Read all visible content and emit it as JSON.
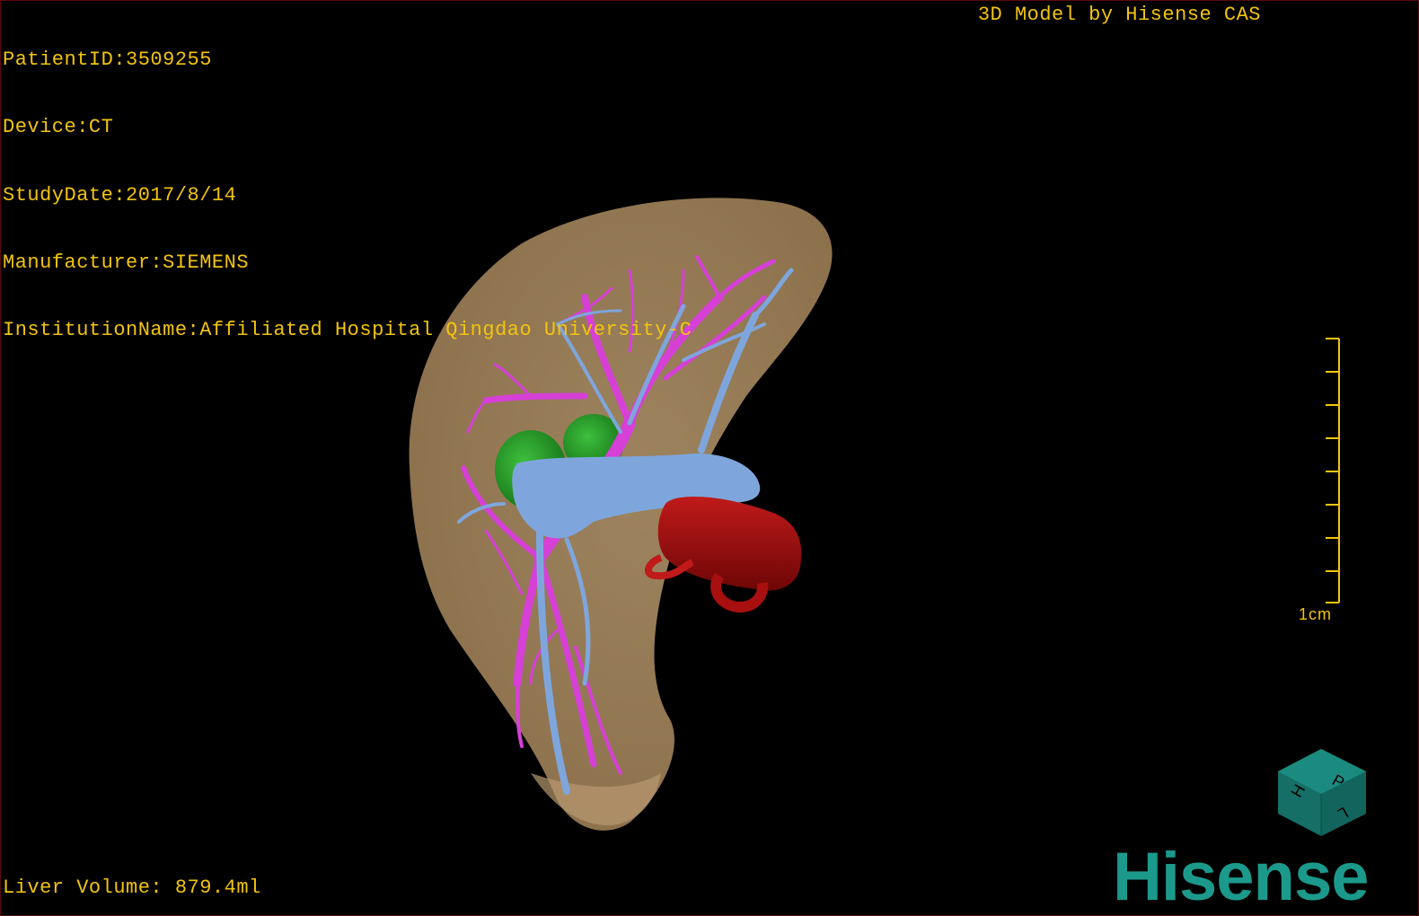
{
  "overlay": {
    "patient_id": "PatientID:3509255",
    "device": "Device:CT",
    "study_date": "StudyDate:2017/8/14",
    "manufacturer": "Manufacturer:SIEMENS",
    "institution": "InstitutionName:Affiliated Hospital Qingdao University-C",
    "model_credit": "3D Model by Hisense CAS",
    "liver_volume": "Liver Volume: 879.4ml"
  },
  "scale_bar": {
    "label": "1cm",
    "ticks": 8
  },
  "orientation_cube": {
    "faces": [
      "P",
      "H",
      "L"
    ]
  },
  "brand": {
    "name": "Hisense"
  },
  "colors": {
    "text": "#f2c40d",
    "liver": "#c4a478",
    "hepatic_vein": "#7ea6dc",
    "portal_vein": "#d640d6",
    "tumor": "#2fa32f",
    "kidney_artery": "#9b0c0c",
    "brand": "#1b9a8c"
  }
}
